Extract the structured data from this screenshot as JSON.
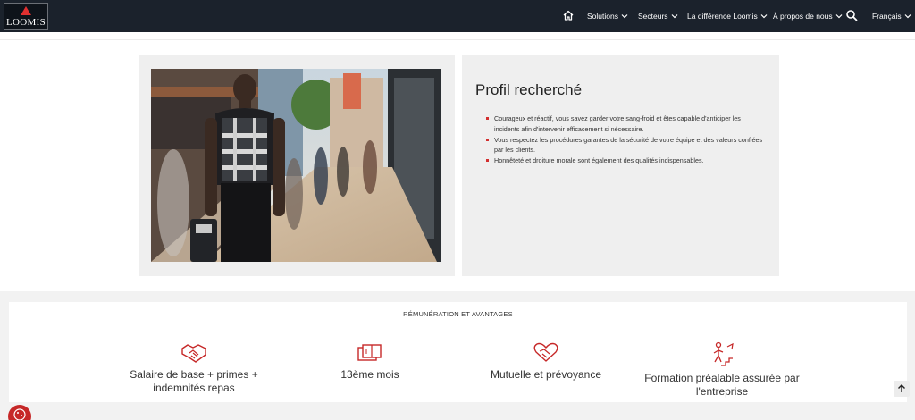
{
  "header": {
    "logo_text": "LOOMIS",
    "nav": [
      {
        "label": "Solutions",
        "icon": "chevron-down-icon"
      },
      {
        "label": "Secteurs",
        "icon": "chevron-down-icon"
      },
      {
        "label": "La différence Loomis",
        "icon": "chevron-down-icon"
      },
      {
        "label": "À propos de nous",
        "icon": "chevron-down-icon"
      }
    ],
    "language": "Français",
    "icons": {
      "home": "home-icon",
      "search": "search-icon"
    }
  },
  "profile": {
    "title": "Profil recherché",
    "items": [
      "Courageux et réactif, vous savez garder votre sang-froid et êtes capable d'anticiper les incidents afin d'intervenir efficacement si nécessaire.",
      "Vous respectez les procédures garantes de la sécurité de votre équipe et des valeurs confiées par les clients.",
      "Honnêteté et droiture morale sont également des qualités indispensables."
    ],
    "image_icon": "security-guard-photo",
    "bullet_color": "#d32f2f"
  },
  "benefits": {
    "title": "RÉMUNÉRATION ET AVANTAGES",
    "items": [
      {
        "label": "Salaire de base + primes + indemnités repas",
        "icon": "handshake-icon"
      },
      {
        "label": "13ème mois",
        "icon": "banknotes-icon"
      },
      {
        "label": "Mutuelle et prévoyance",
        "icon": "heart-hand-icon"
      },
      {
        "label": "Formation préalable assurée par l'entreprise",
        "icon": "training-stairs-icon"
      }
    ],
    "accent": "#c62828"
  },
  "colors": {
    "header_bg": "#1b222c",
    "accent": "#d32f2f",
    "card_bg": "#efefef"
  }
}
